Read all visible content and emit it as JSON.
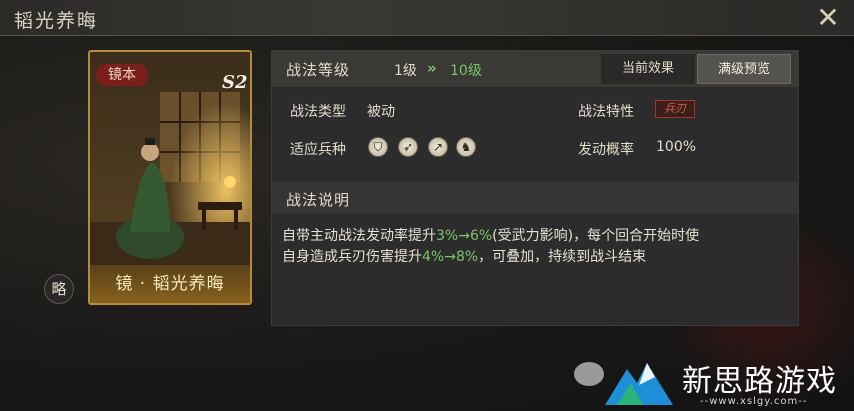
{
  "window": {
    "title": "韬光养晦",
    "close_icon": "close-icon"
  },
  "card": {
    "tag": "镜本",
    "grade": "S2",
    "name": "镜 · 韬光养晦"
  },
  "short_badge": "略",
  "level": {
    "label": "战法等级",
    "from": "1级",
    "arrow": "»",
    "to": "10级"
  },
  "tabs": {
    "current": "当前效果",
    "max": "满级预览"
  },
  "info": {
    "type_label": "战法类型",
    "type_value": "被动",
    "trait_label": "战法特性",
    "trait_value": "兵刃",
    "troops_label": "适应兵种",
    "troops": [
      "shield-troop-icon",
      "bow-troop-icon",
      "spear-troop-icon",
      "horse-troop-icon"
    ],
    "rate_label": "发动概率",
    "rate_value": "100%"
  },
  "desc": {
    "title": "战法说明",
    "line1_a": "自带主动战法发动率提升",
    "line1_hl": "3%→6%",
    "line1_b": "(受武力影响)，每个回合开始时使",
    "line2_a": "自身造成兵刃伤害提升",
    "line2_hl": "4%→8%",
    "line2_b": "，可叠加，持续到战斗结束"
  },
  "watermark": {
    "text": "新思路游戏",
    "url": "--www.xslgy.com--"
  },
  "colors": {
    "highlight": "#7cc46a",
    "trait": "#e05a4a",
    "card_border": "#b58a3a"
  }
}
